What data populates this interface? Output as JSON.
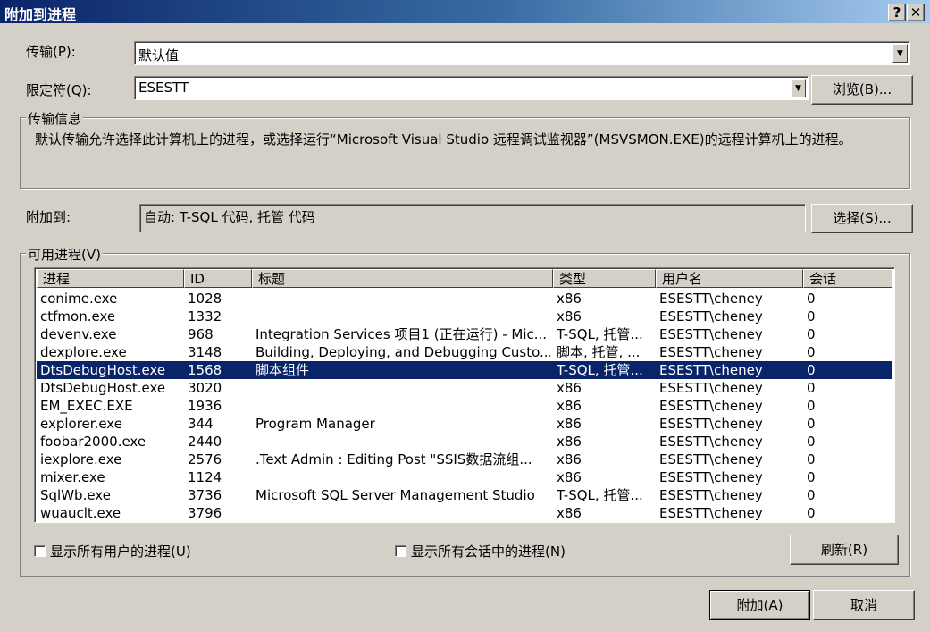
{
  "window": {
    "title": "附加到进程",
    "help": "?",
    "close": "✕"
  },
  "transport": {
    "label": "传输(P):",
    "value": "默认值"
  },
  "qualifier": {
    "label": "限定符(Q):",
    "value": "ESESTT",
    "browse_label": "浏览(B)..."
  },
  "transport_info": {
    "legend": "传输信息",
    "text": "默认传输允许选择此计算机上的进程，或选择运行“Microsoft Visual Studio 远程调试监视器”(MSVSMON.EXE)的远程计算机上的进程。"
  },
  "attach_to": {
    "label": "附加到:",
    "value": "自动: T-SQL 代码, 托管 代码",
    "select_label": "选择(S)..."
  },
  "processes": {
    "legend": "可用进程(V)",
    "columns": [
      "进程",
      "ID",
      "标题",
      "类型",
      "用户名",
      "会话"
    ],
    "rows": [
      [
        "conime.exe",
        "1028",
        "",
        "x86",
        "ESESTT\\cheney",
        "0"
      ],
      [
        "ctfmon.exe",
        "1332",
        "",
        "x86",
        "ESESTT\\cheney",
        "0"
      ],
      [
        "devenv.exe",
        "968",
        "Integration Services 项目1 (正在运行) - Mic...",
        "T-SQL, 托管...",
        "ESESTT\\cheney",
        "0"
      ],
      [
        "dexplore.exe",
        "3148",
        "Building, Deploying, and Debugging Custo...",
        "脚本, 托管, ...",
        "ESESTT\\cheney",
        "0"
      ],
      [
        "DtsDebugHost.exe",
        "1568",
        "脚本组件",
        "T-SQL, 托管...",
        "ESESTT\\cheney",
        "0"
      ],
      [
        "DtsDebugHost.exe",
        "3020",
        "",
        "x86",
        "ESESTT\\cheney",
        "0"
      ],
      [
        "EM_EXEC.EXE",
        "1936",
        "",
        "x86",
        "ESESTT\\cheney",
        "0"
      ],
      [
        "explorer.exe",
        "344",
        "Program Manager",
        "x86",
        "ESESTT\\cheney",
        "0"
      ],
      [
        "foobar2000.exe",
        "2440",
        "",
        "x86",
        "ESESTT\\cheney",
        "0"
      ],
      [
        "iexplore.exe",
        "2576",
        ".Text Admin : Editing Post \"SSIS数据流组...",
        "x86",
        "ESESTT\\cheney",
        "0"
      ],
      [
        "mixer.exe",
        "1124",
        "",
        "x86",
        "ESESTT\\cheney",
        "0"
      ],
      [
        "SqlWb.exe",
        "3736",
        "Microsoft SQL Server Management Studio",
        "T-SQL, 托管...",
        "ESESTT\\cheney",
        "0"
      ],
      [
        "wuauclt.exe",
        "3796",
        "",
        "x86",
        "ESESTT\\cheney",
        "0"
      ]
    ],
    "selected_index": 4,
    "show_all_users_label": "显示所有用户的进程(U)",
    "show_all_sessions_label": "显示所有会话中的进程(N)",
    "refresh_label": "刷新(R)"
  },
  "buttons": {
    "attach_label": "附加(A)",
    "cancel_label": "取消"
  }
}
